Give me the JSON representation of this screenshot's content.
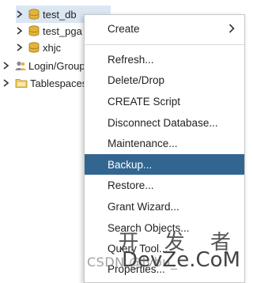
{
  "tree": {
    "items": [
      {
        "label": "test_db",
        "type": "database",
        "level": 1,
        "selected": true
      },
      {
        "label": "test_pga",
        "type": "database",
        "level": 1
      },
      {
        "label": "xhjc",
        "type": "database",
        "level": 1
      },
      {
        "label": "Login/Group",
        "type": "group",
        "level": 0
      },
      {
        "label": "Tablespaces",
        "type": "folder",
        "level": 0
      }
    ]
  },
  "context_menu": {
    "submenu_item": {
      "label": "Create"
    },
    "items": [
      {
        "label": "Refresh..."
      },
      {
        "label": "Delete/Drop"
      },
      {
        "label": "CREATE Script"
      },
      {
        "label": "Disconnect Database..."
      },
      {
        "label": "Maintenance..."
      },
      {
        "label": "Backup...",
        "active": true
      },
      {
        "label": "Restore..."
      },
      {
        "label": "Grant Wizard..."
      },
      {
        "label": "Search Objects..."
      },
      {
        "label": "Query Tool..."
      },
      {
        "label": "Properties..."
      }
    ]
  },
  "watermark": {
    "top_text": "开 发 者",
    "brand_text": "DevZe.CoM",
    "csdn_text": "CSDN @lvbu_"
  },
  "colors": {
    "menu_active_bg": "#326690",
    "selection_bg": "#dbe6f3",
    "db_icon": "#e2b43a"
  }
}
